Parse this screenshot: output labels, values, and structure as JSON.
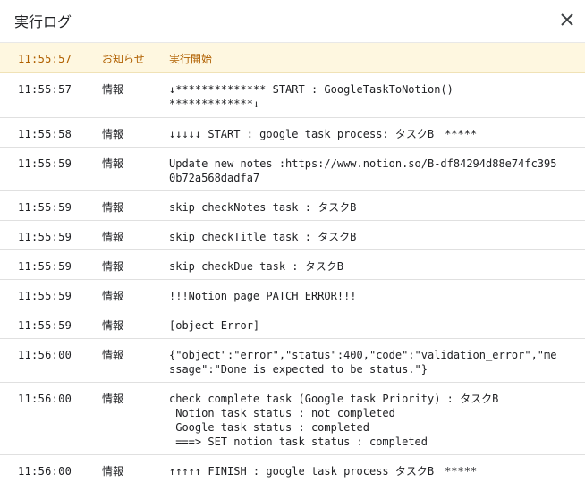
{
  "dialog": {
    "title": "実行ログ",
    "close_icon": "close-icon"
  },
  "log": [
    {
      "time": "11:55:57",
      "type": "お知らせ",
      "message": "実行開始"
    },
    {
      "time": "11:55:57",
      "type": "情報",
      "message": "↓************** START : GoogleTaskToNotion()\n*************↓"
    },
    {
      "time": "11:55:58",
      "type": "情報",
      "message": "↓↓↓↓↓ START : google task process: タスクB　*****"
    },
    {
      "time": "11:55:59",
      "type": "情報",
      "message": "Update new notes :https://www.notion.so/B-df84294d88e74fc3950b72a568dadfa7"
    },
    {
      "time": "11:55:59",
      "type": "情報",
      "message": "skip checkNotes task : タスクB"
    },
    {
      "time": "11:55:59",
      "type": "情報",
      "message": "skip checkTitle task : タスクB"
    },
    {
      "time": "11:55:59",
      "type": "情報",
      "message": "skip checkDue task : タスクB"
    },
    {
      "time": "11:55:59",
      "type": "情報",
      "message": "!!!Notion page PATCH ERROR!!!"
    },
    {
      "time": "11:55:59",
      "type": "情報",
      "message": "[object Error]"
    },
    {
      "time": "11:56:00",
      "type": "情報",
      "message": "{\"object\":\"error\",\"status\":400,\"code\":\"validation_error\",\"message\":\"Done is expected to be status.\"}"
    },
    {
      "time": "11:56:00",
      "type": "情報",
      "message": "check complete task (Google task Priority) : タスクB\n Notion task status : not completed\n Google task status : completed\n ===> SET notion task status : completed"
    },
    {
      "time": "11:56:00",
      "type": "情報",
      "message": "↑↑↑↑↑ FINISH : google task process タスクB　*****"
    }
  ]
}
